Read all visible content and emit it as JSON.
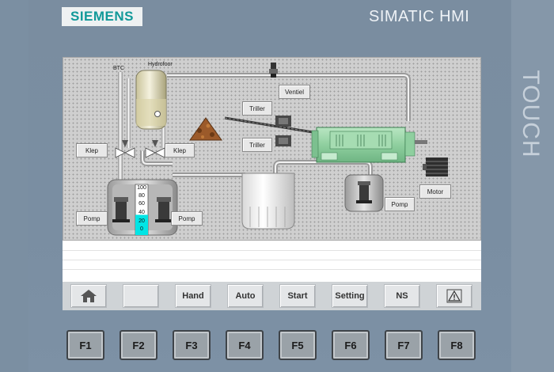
{
  "device": {
    "brand": "SIEMENS",
    "product": "SIMATIC HMI",
    "side_label": "TOUCH"
  },
  "process": {
    "labels": {
      "btc": "BTC",
      "hydrofoor": "Hydrofoor"
    },
    "buttons": {
      "ventiel": "Ventiel",
      "triller_top": "Triller",
      "triller_bottom": "Triller",
      "klep_left": "Klep",
      "klep_right": "Klep",
      "pomp_left": "Pomp",
      "pomp_right": "Pomp",
      "pomp_tank": "Pomp",
      "motor": "Motor"
    },
    "level_scale": [
      "100",
      "80",
      "60",
      "40",
      "20",
      "0"
    ],
    "level_fill_percent": 40
  },
  "navbar": {
    "home_icon": "home-icon",
    "blank": "",
    "hand": "Hand",
    "auto": "Auto",
    "start": "Start",
    "setting": "Setting",
    "ns": "NS",
    "alarm_icon": "warning-triangle-icon"
  },
  "function_keys": [
    "F1",
    "F2",
    "F3",
    "F4",
    "F5",
    "F6",
    "F7",
    "F8"
  ],
  "colors": {
    "brand": "#119999",
    "level_fill": "#00e5e5",
    "machine_green": "#9bd5a8",
    "panel_grey": "#cfcfcf"
  }
}
